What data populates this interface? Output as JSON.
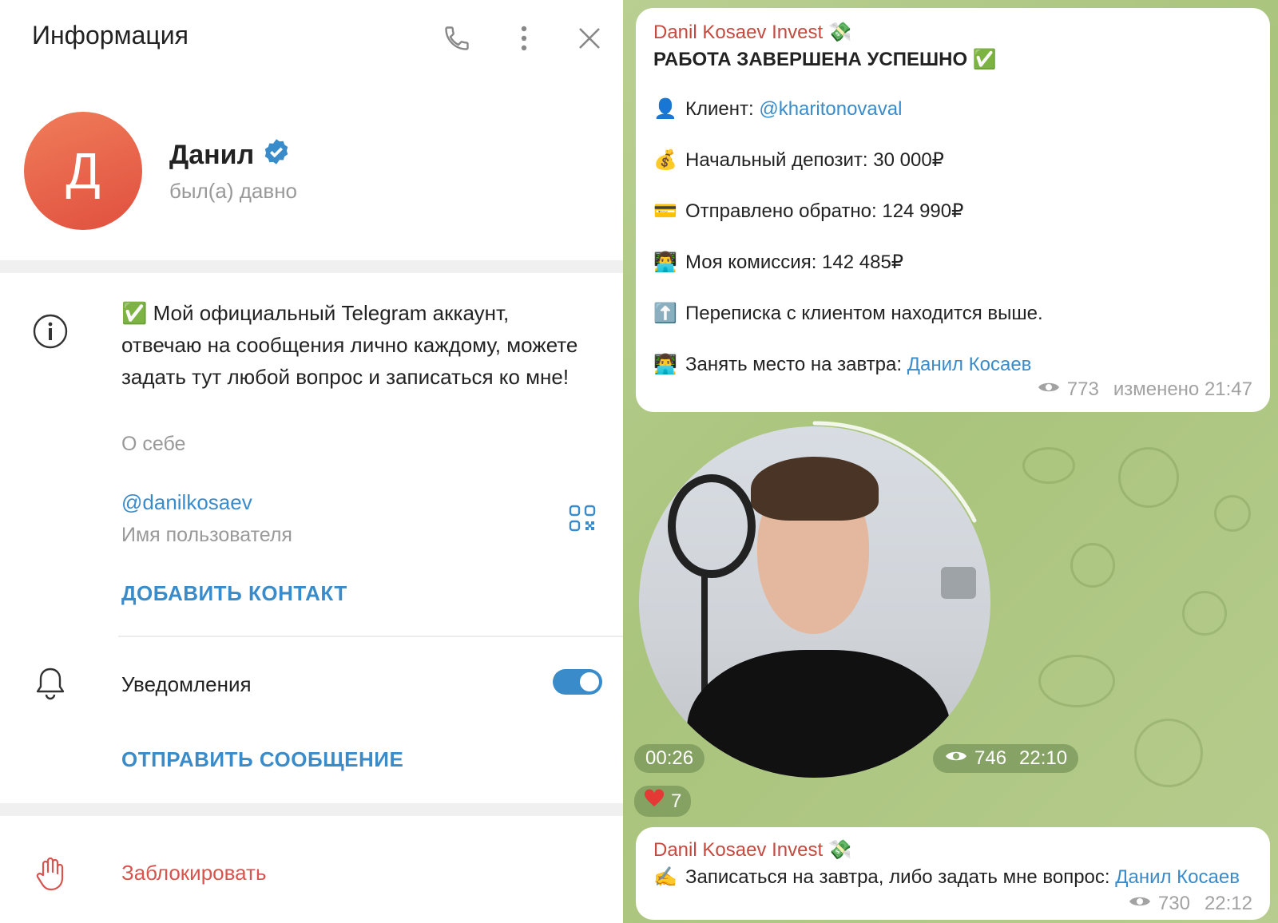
{
  "left": {
    "header": {
      "title": "Информация",
      "icons": [
        "phone-icon",
        "more-vertical-icon",
        "close-icon"
      ]
    },
    "profile": {
      "avatar_letter": "Д",
      "name": "Данил",
      "status": "был(а) давно",
      "verified": true
    },
    "bio": {
      "text": "✅ Мой официальный Telegram аккаунт, отвечаю на сообщения лично каждому, можете задать тут любой вопрос и записаться ко мне!",
      "caption": "О себе"
    },
    "username": {
      "value": "@danilkosaev",
      "caption": "Имя пользователя"
    },
    "add_contact": "ДОБАВИТЬ КОНТАКТ",
    "notifications": {
      "label": "Уведомления",
      "enabled": true
    },
    "send_message": "ОТПРАВИТЬ СООБЩЕНИЕ",
    "block": "Заблокировать",
    "colors": {
      "accent": "#3a8bc9",
      "danger": "#d9534f",
      "avatar": "#e8603f"
    }
  },
  "right": {
    "message1": {
      "author": "Danil Kosaev Invest 💸",
      "title": "РАБОТА ЗАВЕРШЕНА УСПЕШНО ✅",
      "lines": [
        {
          "emoji": "👤",
          "text": "Клиент: ",
          "link": "@kharitonovaval"
        },
        {
          "emoji": "💰",
          "text": "Начальный депозит: 30 000₽",
          "link": ""
        },
        {
          "emoji": "💳",
          "text": "Отправлено обратно: 124 990₽",
          "link": ""
        },
        {
          "emoji": "👨‍💻",
          "text": "Моя комиссия: 142 485₽",
          "link": ""
        },
        {
          "emoji": "⬆️",
          "text": "Переписка с клиентом находится выше.",
          "link": ""
        },
        {
          "emoji": "👨‍💻",
          "text": "Занять место на завтра: ",
          "link": "Данил Косаев"
        }
      ],
      "views": "773",
      "time": "изменено 21:47"
    },
    "video": {
      "duration": "00:26",
      "views": "746",
      "time": "22:10",
      "reaction_count": "7"
    },
    "message2": {
      "author": "Danil Kosaev Invest 💸",
      "emoji": "✍️",
      "text": "Записаться на завтра, либо задать мне вопрос: ",
      "link": "Данил Косаев",
      "views": "730",
      "time": "22:12"
    }
  }
}
